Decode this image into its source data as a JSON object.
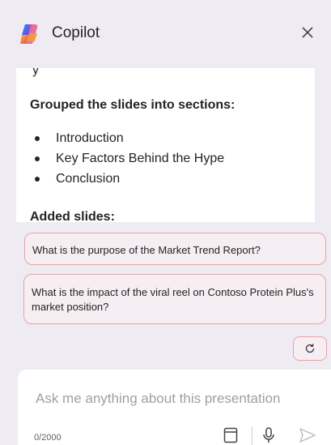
{
  "header": {
    "title": "Copilot"
  },
  "card": {
    "partial_line": "y",
    "heading": "Grouped the slides into sections:",
    "sections": [
      "Introduction",
      "Key Factors Behind the Hype",
      "Conclusion"
    ],
    "heading2": "Added slides:"
  },
  "suggestions": [
    "What is the purpose of the Market Trend Report?",
    "What is the impact of the viral reel on Contoso Protein Plus's market position?"
  ],
  "composer": {
    "placeholder": "Ask me anything about this presentation",
    "counter": "0/2000"
  },
  "icons": {
    "logo": "copilot-logo",
    "close": "close-icon",
    "refresh": "refresh-icon",
    "notebook": "notebook-icon",
    "mic": "microphone-icon",
    "send": "send-icon"
  },
  "colors": {
    "background": "#efebf3",
    "suggestion_border": "#e6a3a6",
    "suggestion_fill": "#f6eef2"
  }
}
